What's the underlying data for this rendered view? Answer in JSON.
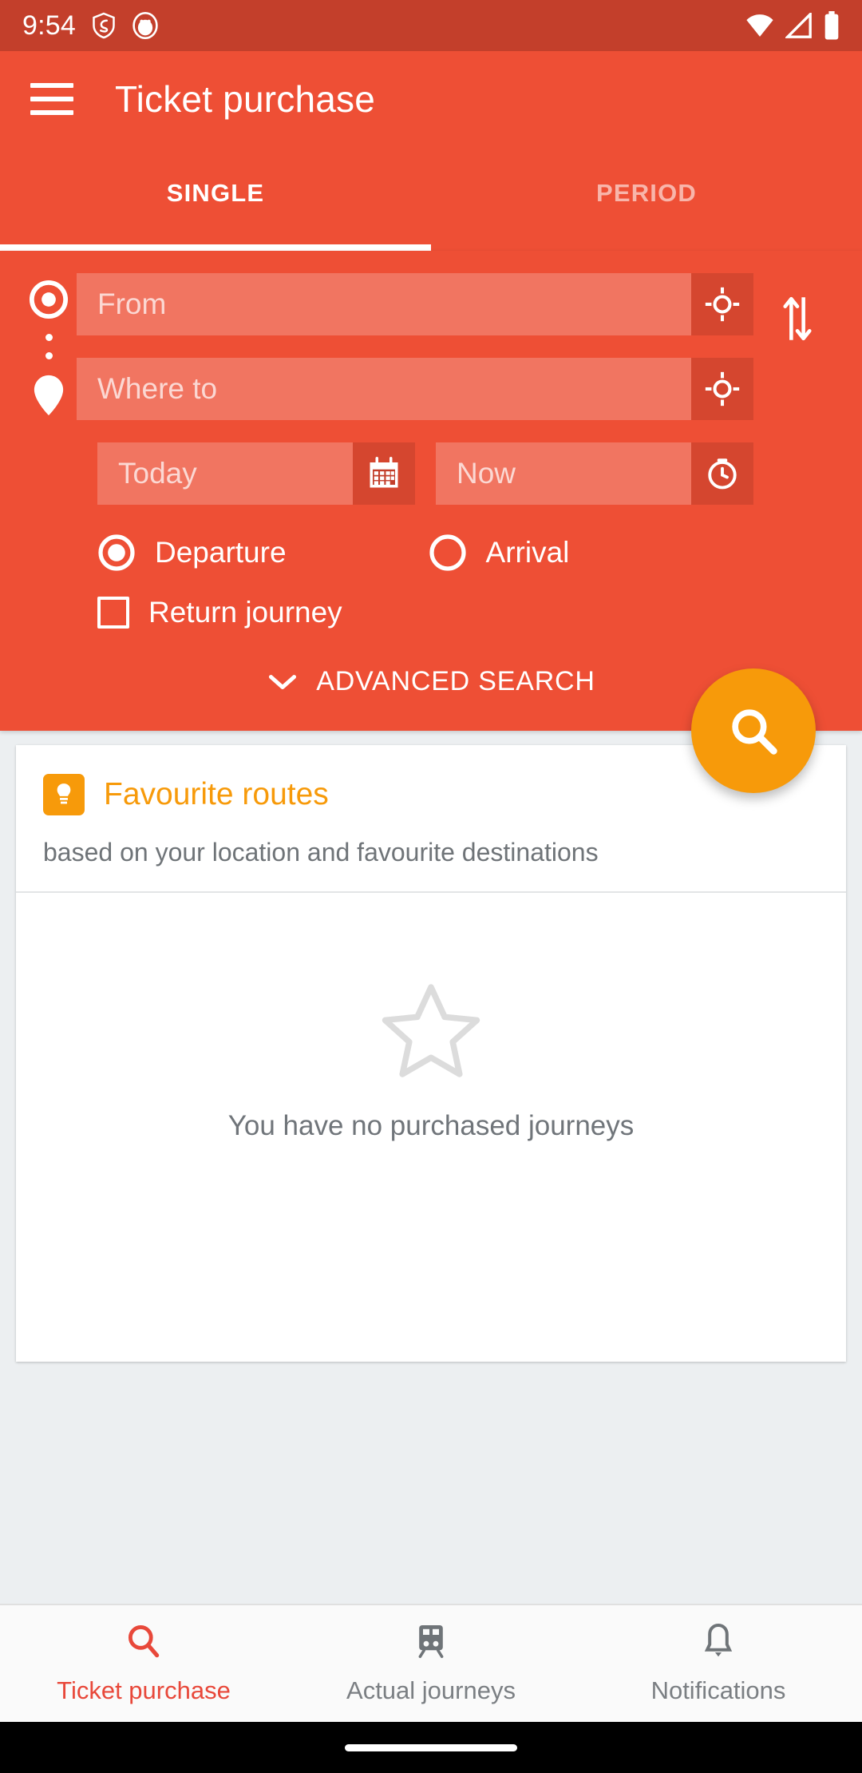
{
  "status_bar": {
    "time": "9:54",
    "left_icons": [
      "shield-icon",
      "app-badge-icon"
    ],
    "right_icons": [
      "wifi-icon",
      "cellular-signal-icon",
      "battery-icon"
    ]
  },
  "app_bar": {
    "menu_icon": "hamburger-menu-icon",
    "title": "Ticket purchase"
  },
  "tabs": [
    {
      "label": "SINGLE",
      "active": true
    },
    {
      "label": "PERIOD",
      "active": false
    }
  ],
  "search_form": {
    "from": {
      "placeholder": "From",
      "value": "",
      "marker_icon": "origin-dot-icon",
      "action_icon": "gps-locate-icon"
    },
    "where_to": {
      "placeholder": "Where to",
      "value": "",
      "marker_icon": "destination-pin-icon",
      "action_icon": "gps-locate-icon"
    },
    "swap_icon": "swap-vertical-icon",
    "date": {
      "placeholder": "Today",
      "value": "",
      "action_icon": "calendar-icon"
    },
    "time": {
      "placeholder": "Now",
      "value": "",
      "action_icon": "clock-icon"
    },
    "departure_arrival": {
      "options": [
        {
          "label": "Departure",
          "selected": true
        },
        {
          "label": "Arrival",
          "selected": false
        }
      ]
    },
    "return_journey": {
      "label": "Return journey",
      "checked": false
    },
    "advanced_search": {
      "label": "ADVANCED SEARCH",
      "icon": "chevron-down-icon"
    },
    "search_fab": {
      "icon": "search-icon",
      "color": "#f79a0a"
    }
  },
  "favourite_routes_card": {
    "icon": "lightbulb-icon",
    "title": "Favourite routes",
    "subtitle": "based on your location and favourite destinations",
    "empty_state": {
      "icon": "star-outline-icon",
      "text": "You have no purchased journeys"
    }
  },
  "bottom_nav": [
    {
      "label": "Ticket purchase",
      "icon": "search-icon",
      "active": true
    },
    {
      "label": "Actual journeys",
      "icon": "train-icon",
      "active": false
    },
    {
      "label": "Notifications",
      "icon": "bell-icon",
      "active": false
    }
  ],
  "colors": {
    "primary": "#ee4f35",
    "primary_dark": "#c33f2b",
    "accent": "#f79a0a",
    "nav_active": "#e8483a"
  }
}
